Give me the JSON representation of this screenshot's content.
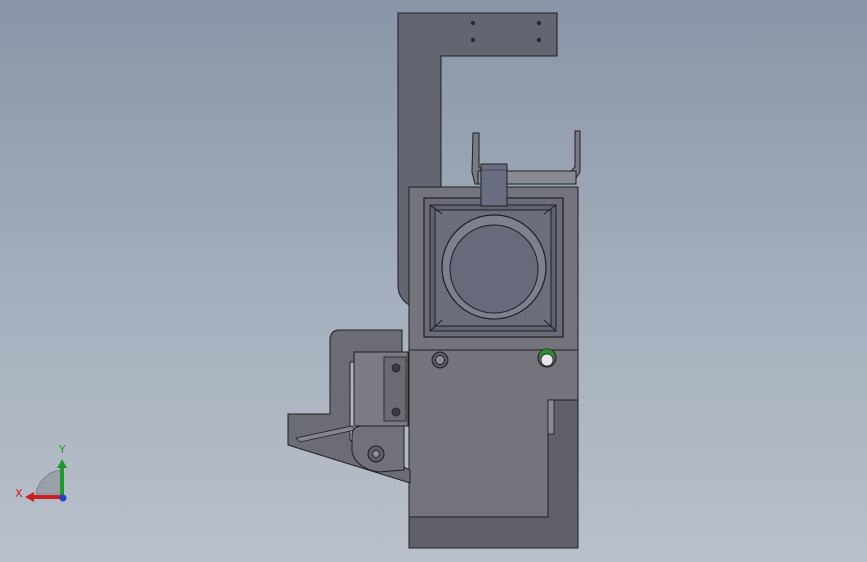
{
  "viewport": {
    "kind": "3D CAD model view",
    "view_orientation": "front",
    "background_colors": [
      "#8995a6",
      "#b9c0ca"
    ]
  },
  "triad": {
    "x_label": "X",
    "y_label": "Y",
    "x_color": "#cc1f1f",
    "y_color": "#1f9a2a",
    "z_color": "#1f3fcc"
  },
  "model": {
    "part_colors": {
      "body": "#73737a",
      "bracket": "#63656e",
      "motor": "#666a7a",
      "outline": "#1f1f22"
    }
  }
}
